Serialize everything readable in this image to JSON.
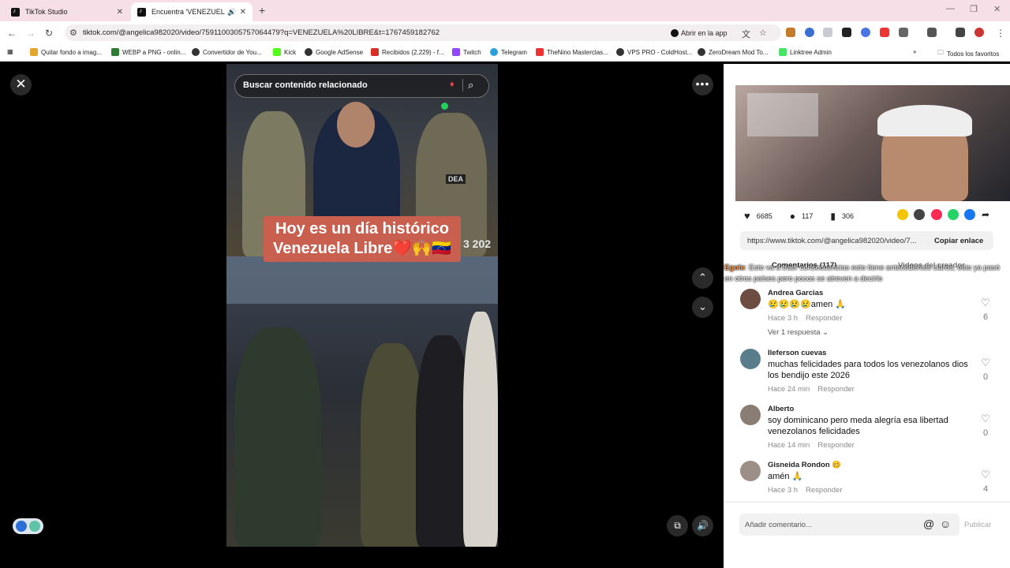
{
  "browser": {
    "tabs": [
      {
        "title": "TikTok Studio"
      },
      {
        "title": "Encuentra 'VENEZUELA LIB"
      }
    ],
    "url": "tiktok.com/@angelica982020/video/7591100305757064479?q=VENEZUELA%20LIBRE&t=1767459182762",
    "open_in_app": "Abrir en la app",
    "bookmarks": [
      "Quitar fondo a imag...",
      "WEBP a PNG - onlin...",
      "Convertidor de You...",
      "Kick",
      "Google AdSense",
      "Recibidos (2,229) - f...",
      "Twitch",
      "Telegram",
      "TheNino Masterclas...",
      "VPS PRO - ColdHost...",
      "ZeroDream Mod To...",
      "Linktree Admin"
    ],
    "all_bookmarks": "Todos los favoritos"
  },
  "viewer": {
    "search_placeholder": "Buscar contenido relacionado",
    "caption_line1": "Hoy es un día histórico",
    "caption_line2": "Venezuela Libre❤️🙌🇻🇪",
    "overlay_code": "3 202",
    "badge": "DEA"
  },
  "panel": {
    "stats": {
      "likes": "6685",
      "comments": "117",
      "saves": "306"
    },
    "link": "https://www.tiktok.com/@angelica982020/video/7...",
    "copy_link": "Copiar enlace",
    "tab_comments": "Comentarios (117)",
    "tab_creator": "Videos del creador",
    "overlay_comment_user": "Egole",
    "overlay_comment_text": ": Esto va a traer consecuencias esto tiene antecedentes claros, esto ya pasó en otros países pero pocos se atreven a decirlo",
    "comments": [
      {
        "name": "Andrea Garcias",
        "text": "😢😢😢😢amen 🙏",
        "time": "Hace 3 h",
        "reply": "Responder",
        "likes": "6"
      },
      {
        "name": "Ileferson cuevas",
        "text": "muchas felicidades para todos los venezolanos dios los bendijo este 2026",
        "time": "Hace 24 min",
        "reply": "Responder",
        "likes": "0"
      },
      {
        "name": "Alberto",
        "text": "soy dominicano pero meda alegría esa libertad venezolanos felicidades",
        "time": "Hace 14 min",
        "reply": "Responder",
        "likes": "0"
      },
      {
        "name": "Gisneida Rondon 🥴",
        "text": "amén 🙏",
        "time": "Hace 3 h",
        "reply": "Responder",
        "likes": "4"
      }
    ],
    "view_replies": "Ver 1 respuesta ⌄",
    "add_comment_placeholder": "Añadir comentario...",
    "publish": "Publicar"
  }
}
